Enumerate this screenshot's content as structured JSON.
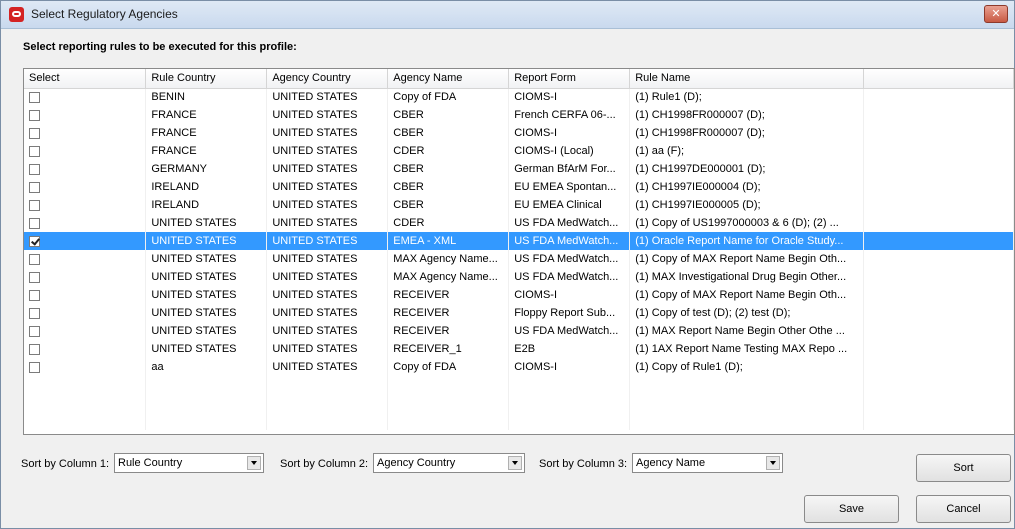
{
  "window": {
    "title": "Select Regulatory Agencies"
  },
  "instruction": "Select reporting rules to be executed for this profile:",
  "columns": [
    "Select",
    "Rule Country",
    "Agency Country",
    "Agency Name",
    "Report Form",
    "Rule Name"
  ],
  "rows": [
    {
      "checked": false,
      "rule_country": "BENIN",
      "agency_country": "UNITED STATES",
      "agency_name": "Copy of FDA",
      "report_form": "CIOMS-I",
      "rule_name": "(1) Rule1 (D);"
    },
    {
      "checked": false,
      "rule_country": "FRANCE",
      "agency_country": "UNITED STATES",
      "agency_name": "CBER",
      "report_form": "French CERFA 06-...",
      "rule_name": "(1) CH1998FR000007 (D);"
    },
    {
      "checked": false,
      "rule_country": "FRANCE",
      "agency_country": "UNITED STATES",
      "agency_name": "CBER",
      "report_form": "CIOMS-I",
      "rule_name": "(1) CH1998FR000007 (D);"
    },
    {
      "checked": false,
      "rule_country": "FRANCE",
      "agency_country": "UNITED STATES",
      "agency_name": "CDER",
      "report_form": "CIOMS-I (Local)",
      "rule_name": "(1) aa (F);"
    },
    {
      "checked": false,
      "rule_country": "GERMANY",
      "agency_country": "UNITED STATES",
      "agency_name": "CBER",
      "report_form": "German BfArM For...",
      "rule_name": "(1) CH1997DE000001 (D);"
    },
    {
      "checked": false,
      "rule_country": "IRELAND",
      "agency_country": "UNITED STATES",
      "agency_name": "CBER",
      "report_form": "EU EMEA Spontan...",
      "rule_name": "(1) CH1997IE000004 (D);"
    },
    {
      "checked": false,
      "rule_country": "IRELAND",
      "agency_country": "UNITED STATES",
      "agency_name": "CBER",
      "report_form": "EU EMEA Clinical",
      "rule_name": "(1) CH1997IE000005 (D);"
    },
    {
      "checked": false,
      "rule_country": "UNITED STATES",
      "agency_country": "UNITED STATES",
      "agency_name": "CDER",
      "report_form": "US FDA MedWatch...",
      "rule_name": "(1) Copy of US1997000003 & 6 (D); (2) ..."
    },
    {
      "checked": true,
      "rule_country": "UNITED STATES",
      "agency_country": "UNITED STATES",
      "agency_name": "EMEA - XML",
      "report_form": "US FDA MedWatch...",
      "rule_name": "(1) Oracle Report Name for Oracle Study..."
    },
    {
      "checked": false,
      "rule_country": "UNITED STATES",
      "agency_country": "UNITED STATES",
      "agency_name": "MAX Agency Name...",
      "report_form": "US FDA MedWatch...",
      "rule_name": "(1) Copy of MAX Report Name Begin Oth..."
    },
    {
      "checked": false,
      "rule_country": "UNITED STATES",
      "agency_country": "UNITED STATES",
      "agency_name": "MAX Agency Name...",
      "report_form": "US FDA MedWatch...",
      "rule_name": "(1) MAX Investigational Drug Begin Other..."
    },
    {
      "checked": false,
      "rule_country": "UNITED STATES",
      "agency_country": "UNITED STATES",
      "agency_name": "RECEIVER",
      "report_form": "CIOMS-I",
      "rule_name": "(1) Copy of MAX Report Name Begin Oth..."
    },
    {
      "checked": false,
      "rule_country": "UNITED STATES",
      "agency_country": "UNITED STATES",
      "agency_name": "RECEIVER",
      "report_form": "Floppy Report Sub...",
      "rule_name": "(1) Copy of test (D); (2) test (D);"
    },
    {
      "checked": false,
      "rule_country": "UNITED STATES",
      "agency_country": "UNITED STATES",
      "agency_name": "RECEIVER",
      "report_form": "US FDA MedWatch...",
      "rule_name": "(1) MAX Report Name Begin Other Othe ..."
    },
    {
      "checked": false,
      "rule_country": "UNITED STATES",
      "agency_country": "UNITED STATES",
      "agency_name": "RECEIVER_1",
      "report_form": "E2B",
      "rule_name": "(1) 1AX Report Name Testing MAX Repo ..."
    },
    {
      "checked": false,
      "rule_country": "aa",
      "agency_country": "UNITED STATES",
      "agency_name": "Copy of FDA",
      "report_form": "CIOMS-I",
      "rule_name": "(1) Copy of Rule1 (D);"
    }
  ],
  "selected_row_index": 8,
  "sort": [
    {
      "label": "Sort by Column 1:",
      "value": "Rule Country"
    },
    {
      "label": "Sort by Column 2:",
      "value": "Agency Country"
    },
    {
      "label": "Sort by Column 3:",
      "value": "Agency Name"
    }
  ],
  "buttons": {
    "sort": "Sort",
    "save": "Save",
    "cancel": "Cancel"
  },
  "colors": {
    "selection": "#3399ff",
    "close": "#c85a44"
  }
}
